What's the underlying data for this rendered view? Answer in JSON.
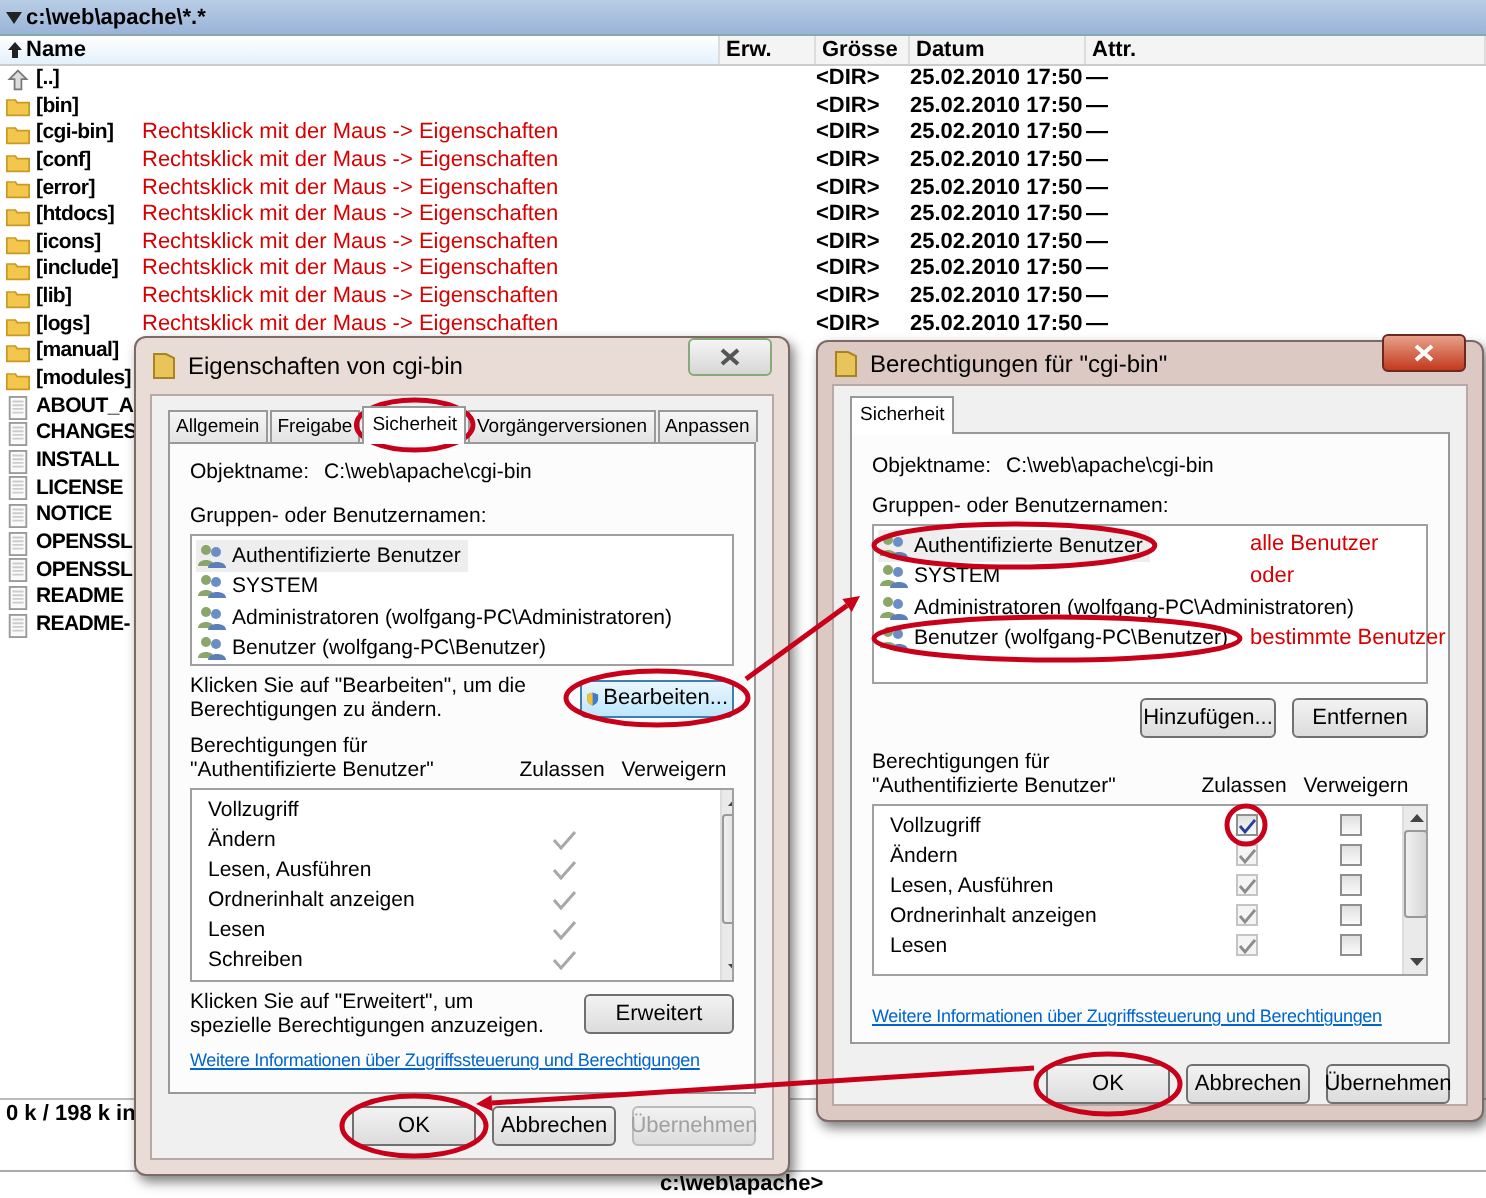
{
  "file_manager": {
    "path": "c:\\web\\apache\\*.*",
    "columns": [
      {
        "label": "Name",
        "sorted": true
      },
      {
        "label": "Erw.",
        "sorted": false
      },
      {
        "label": "Grösse",
        "sorted": false
      },
      {
        "label": "Datum",
        "sorted": false
      },
      {
        "label": "Attr.",
        "sorted": false
      }
    ],
    "files": [
      {
        "kind": "up",
        "name": "[..]",
        "size": "<DIR>",
        "date": "25.02.2010 17:50",
        "attr": "—"
      },
      {
        "kind": "folder",
        "name": "[bin]",
        "size": "<DIR>",
        "date": "25.02.2010 17:50",
        "attr": "—"
      },
      {
        "kind": "folder",
        "name": "[cgi-bin]",
        "note": "Rechtsklick mit der Maus -> Eigenschaften",
        "size": "<DIR>",
        "date": "25.02.2010 17:50",
        "attr": "—"
      },
      {
        "kind": "folder",
        "name": "[conf]",
        "note": "Rechtsklick mit der Maus -> Eigenschaften",
        "size": "<DIR>",
        "date": "25.02.2010 17:50",
        "attr": "—"
      },
      {
        "kind": "folder",
        "name": "[error]",
        "note": "Rechtsklick mit der Maus -> Eigenschaften",
        "size": "<DIR>",
        "date": "25.02.2010 17:50",
        "attr": "—"
      },
      {
        "kind": "folder",
        "name": "[htdocs]",
        "note": "Rechtsklick mit der Maus -> Eigenschaften",
        "size": "<DIR>",
        "date": "25.02.2010 17:50",
        "attr": "—"
      },
      {
        "kind": "folder",
        "name": "[icons]",
        "note": "Rechtsklick mit der Maus -> Eigenschaften",
        "size": "<DIR>",
        "date": "25.02.2010 17:50",
        "attr": "—"
      },
      {
        "kind": "folder",
        "name": "[include]",
        "note": "Rechtsklick mit der Maus -> Eigenschaften",
        "size": "<DIR>",
        "date": "25.02.2010 17:50",
        "attr": "—"
      },
      {
        "kind": "folder",
        "name": "[lib]",
        "note": "Rechtsklick mit der Maus -> Eigenschaften",
        "size": "<DIR>",
        "date": "25.02.2010 17:50",
        "attr": "—"
      },
      {
        "kind": "folder",
        "name": "[logs]",
        "note": "Rechtsklick mit der Maus -> Eigenschaften",
        "size": "<DIR>",
        "date": "25.02.2010 17:50",
        "attr": "—"
      },
      {
        "kind": "folder",
        "name": "[manual]"
      },
      {
        "kind": "folder",
        "name": "[modules]"
      },
      {
        "kind": "file",
        "name": "ABOUT_A"
      },
      {
        "kind": "file",
        "name": "CHANGES"
      },
      {
        "kind": "file",
        "name": "INSTALL"
      },
      {
        "kind": "file",
        "name": "LICENSE"
      },
      {
        "kind": "file",
        "name": "NOTICE"
      },
      {
        "kind": "file",
        "name": "OPENSSL"
      },
      {
        "kind": "file",
        "name": "OPENSSL"
      },
      {
        "kind": "file",
        "name": "README"
      },
      {
        "kind": "file",
        "name": "README-"
      }
    ],
    "status": "0 k / 198 k in",
    "command_line": "c:\\web\\apache>"
  },
  "dialogs": [
    {
      "title": "Eigenschaften von cgi-bin",
      "active": false,
      "tabs": [
        {
          "label": "Allgemein",
          "selected": false
        },
        {
          "label": "Freigabe",
          "selected": false
        },
        {
          "label": "Sicherheit",
          "selected": true
        },
        {
          "label": "Vorgängerversionen",
          "selected": false
        },
        {
          "label": "Anpassen",
          "selected": false
        }
      ],
      "object_label": "Objektname:",
      "object_name": "C:\\web\\apache\\cgi-bin",
      "groups_label": "Gruppen- oder Benutzernamen:",
      "users": [
        {
          "name": "Authentifizierte Benutzer",
          "selected": true
        },
        {
          "name": "SYSTEM",
          "selected": false
        },
        {
          "name": "Administratoren (wolfgang-PC\\Administratoren)",
          "selected": false
        },
        {
          "name": "Benutzer (wolfgang-PC\\Benutzer)",
          "selected": false
        }
      ],
      "edit_hint": "Klicken Sie auf \"Bearbeiten\", um die Berechtigungen zu ändern.",
      "edit_button": "Bearbeiten...",
      "perms_label": "Berechtigungen für \"Authentifizierte Benutzer\"",
      "allow_header": "Zulassen",
      "deny_header": "Verweigern",
      "permissions": [
        {
          "kind": "tick",
          "label": "Vollzugriff",
          "allowed": false
        },
        {
          "kind": "tick",
          "label": "Ändern",
          "allowed": true
        },
        {
          "kind": "tick",
          "label": "Lesen, Ausführen",
          "allowed": true
        },
        {
          "kind": "tick",
          "label": "Ordnerinhalt anzeigen",
          "allowed": true
        },
        {
          "kind": "tick",
          "label": "Lesen",
          "allowed": true
        },
        {
          "kind": "tick",
          "label": "Schreiben",
          "allowed": true
        }
      ],
      "advanced_hint": "Klicken Sie auf \"Erweitert\", um spezielle Berechtigungen anzuzeigen.",
      "advanced_button": "Erweitert",
      "link": "Weitere Informationen über Zugriffssteuerung und Berechtigungen",
      "buttons": [
        {
          "label": "OK",
          "disabled": false
        },
        {
          "label": "Abbrechen",
          "disabled": false
        },
        {
          "label": "Übernehmen",
          "disabled": true
        }
      ]
    },
    {
      "title": "Berechtigungen für \"cgi-bin\"",
      "active": true,
      "tabs": [
        {
          "label": "Sicherheit",
          "selected": true
        }
      ],
      "object_label": "Objektname:",
      "object_name": "C:\\web\\apache\\cgi-bin",
      "groups_label": "Gruppen- oder Benutzernamen:",
      "users": [
        {
          "name": "Authentifizierte Benutzer",
          "selected": true,
          "note": "alle Benutzer"
        },
        {
          "name": "SYSTEM",
          "selected": false,
          "note": "oder"
        },
        {
          "name": "Administratoren (wolfgang-PC\\Administratoren)",
          "selected": false
        },
        {
          "name": "Benutzer (wolfgang-PC\\Benutzer)",
          "selected": false,
          "note": "bestimmte Benutzer"
        }
      ],
      "list_buttons": [
        "Hinzufügen...",
        "Entfernen"
      ],
      "perms_label": "Berechtigungen für \"Authentifizierte Benutzer\"",
      "allow_header": "Zulassen",
      "deny_header": "Verweigern",
      "permissions": [
        {
          "kind": "checkbox",
          "label": "Vollzugriff",
          "allow": {
            "checked": true,
            "disabled": false
          },
          "deny": {
            "checked": false,
            "disabled": false
          }
        },
        {
          "kind": "checkbox",
          "label": "Ändern",
          "allow": {
            "checked": true,
            "disabled": true
          },
          "deny": {
            "checked": false,
            "disabled": false
          }
        },
        {
          "kind": "checkbox",
          "label": "Lesen, Ausführen",
          "allow": {
            "checked": true,
            "disabled": true
          },
          "deny": {
            "checked": false,
            "disabled": false
          }
        },
        {
          "kind": "checkbox",
          "label": "Ordnerinhalt anzeigen",
          "allow": {
            "checked": true,
            "disabled": true
          },
          "deny": {
            "checked": false,
            "disabled": false
          }
        },
        {
          "kind": "checkbox",
          "label": "Lesen",
          "allow": {
            "checked": true,
            "disabled": true
          },
          "deny": {
            "checked": false,
            "disabled": false
          }
        }
      ],
      "link": "Weitere Informationen über Zugriffssteuerung und Berechtigungen",
      "buttons": [
        {
          "label": "OK",
          "disabled": false
        },
        {
          "label": "Abbrechen",
          "disabled": false
        },
        {
          "label": "Übernehmen",
          "disabled": false
        }
      ]
    }
  ]
}
